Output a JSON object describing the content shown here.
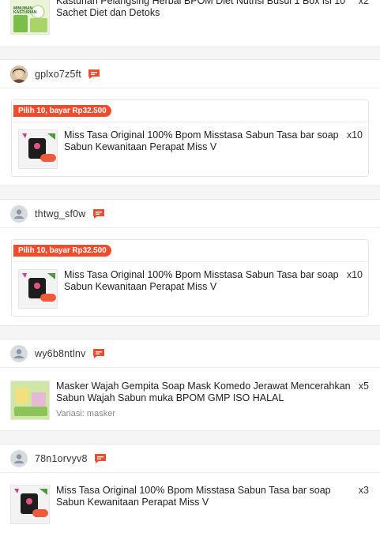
{
  "orders": [
    {
      "product": {
        "name": "Kasturian Pelangsing Herbal BPOM Diet Nutrisi Busui 1 Box isi 10 Sachet Diet dan Detoks",
        "qty": "x2",
        "thumb_text": "MINUMAN KASTURIAN"
      }
    },
    {
      "user": "gplxo7z5ft",
      "avatar": "photo-avatar",
      "promo": "Pilih 10, bayar Rp32.500",
      "product": {
        "name": "Miss Tasa Original 100% Bpom Misstasa Sabun Tasa bar soap Sabun Kewanitaan Perapat Miss V",
        "qty": "x10"
      }
    },
    {
      "user": "thtwg_sf0w",
      "avatar": "default-avatar",
      "promo": "Pilih 10, bayar Rp32.500",
      "product": {
        "name": "Miss Tasa Original 100% Bpom Misstasa Sabun Tasa bar soap Sabun Kewanitaan Perapat Miss V",
        "qty": "x10"
      }
    },
    {
      "user": "wy6b8ntlnv",
      "avatar": "default-avatar",
      "product": {
        "name": "Masker Wajah Gempita Soap Mask Komedo Jerawat Mencerahkan Sabun Wajah Sabun muka BPOM GMP ISO HALAL",
        "qty": "x5",
        "variant": "Variasi: masker"
      }
    },
    {
      "user": "78n1orvyv8",
      "avatar": "default-avatar",
      "product": {
        "name": "Miss Tasa Original 100% Bpom Misstasa Sabun Tasa bar soap Sabun Kewanitaan Perapat Miss V",
        "qty": "x3"
      }
    }
  ],
  "colors": {
    "accent": "#ee4d2d",
    "background": "#f5f5f5"
  }
}
